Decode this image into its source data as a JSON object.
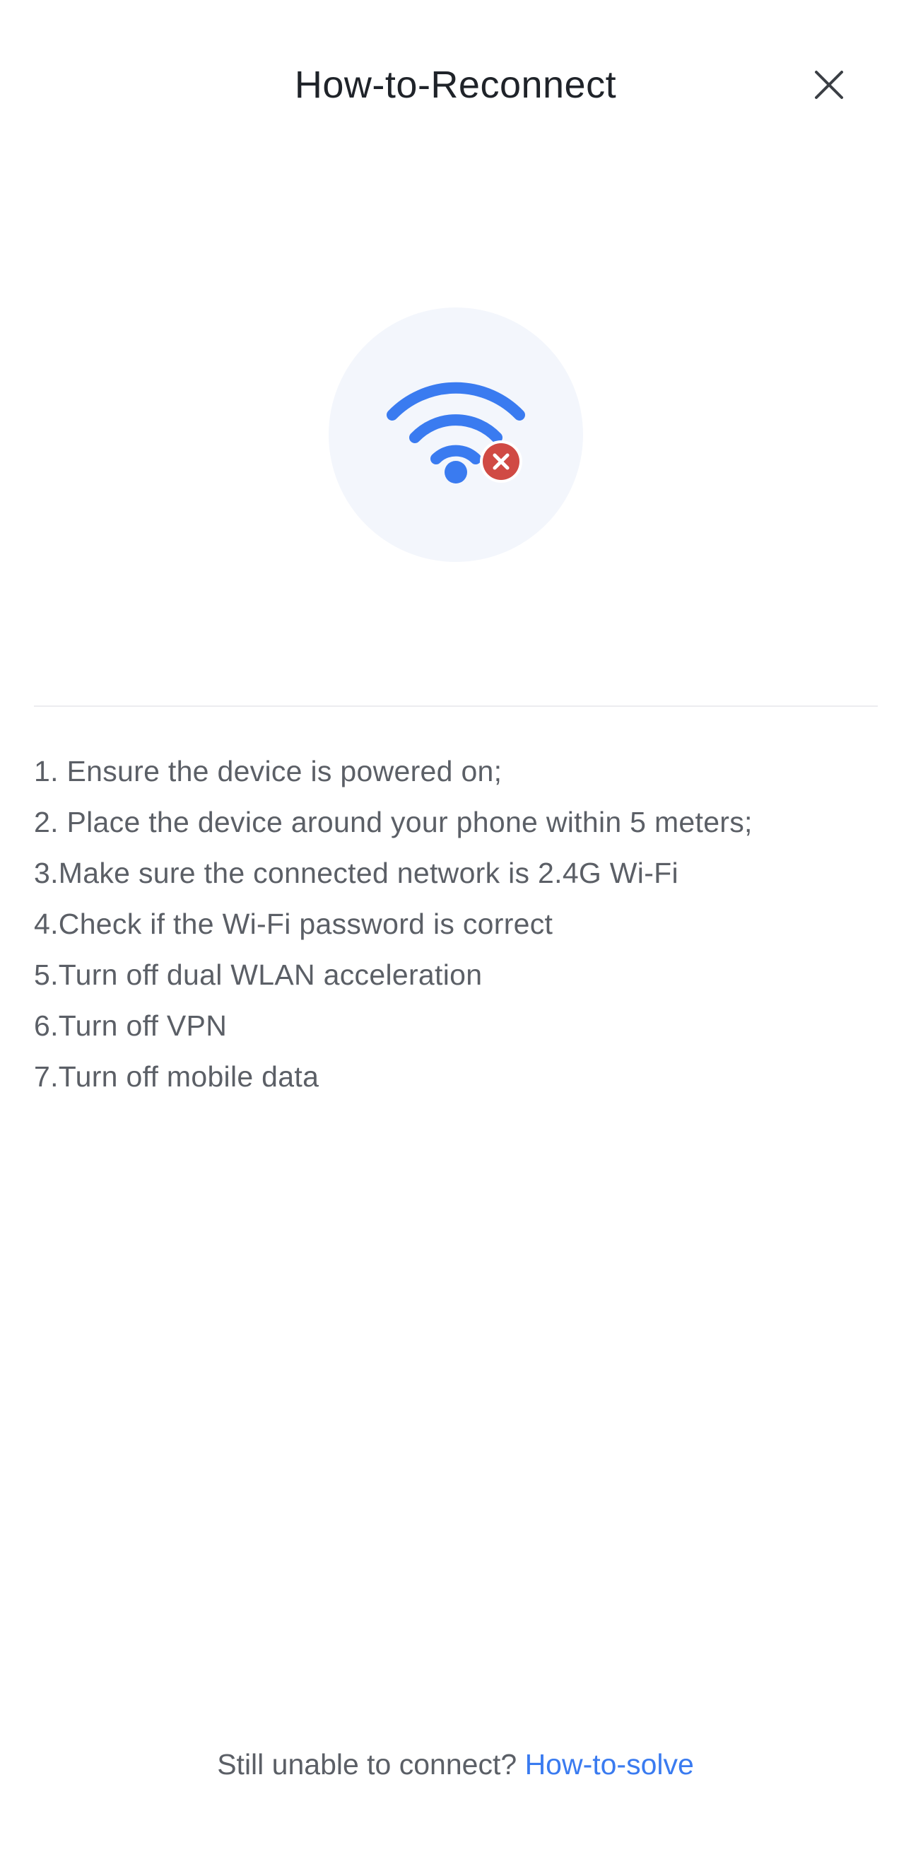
{
  "header": {
    "title": "How-to-Reconnect",
    "close_icon": "close-icon"
  },
  "illustration": {
    "icon": "wifi-disconnected-icon",
    "badge_icon": "error-x-icon",
    "colors": {
      "wifi": "#3a7bf0",
      "badge": "#d04a44",
      "circle_bg": "#f3f6fc"
    }
  },
  "steps": [
    "1. Ensure the device is powered on;",
    "2. Place the device around your phone within 5 meters;",
    "3.Make sure the connected network is 2.4G Wi-Fi",
    "4.Check if the Wi-Fi password is correct",
    "5.Turn off dual WLAN acceleration",
    "6.Turn off VPN",
    "7.Turn off mobile data"
  ],
  "footer": {
    "prompt": "Still unable to connect? ",
    "link_label": "How-to-solve",
    "link_color": "#3a7bf0"
  }
}
